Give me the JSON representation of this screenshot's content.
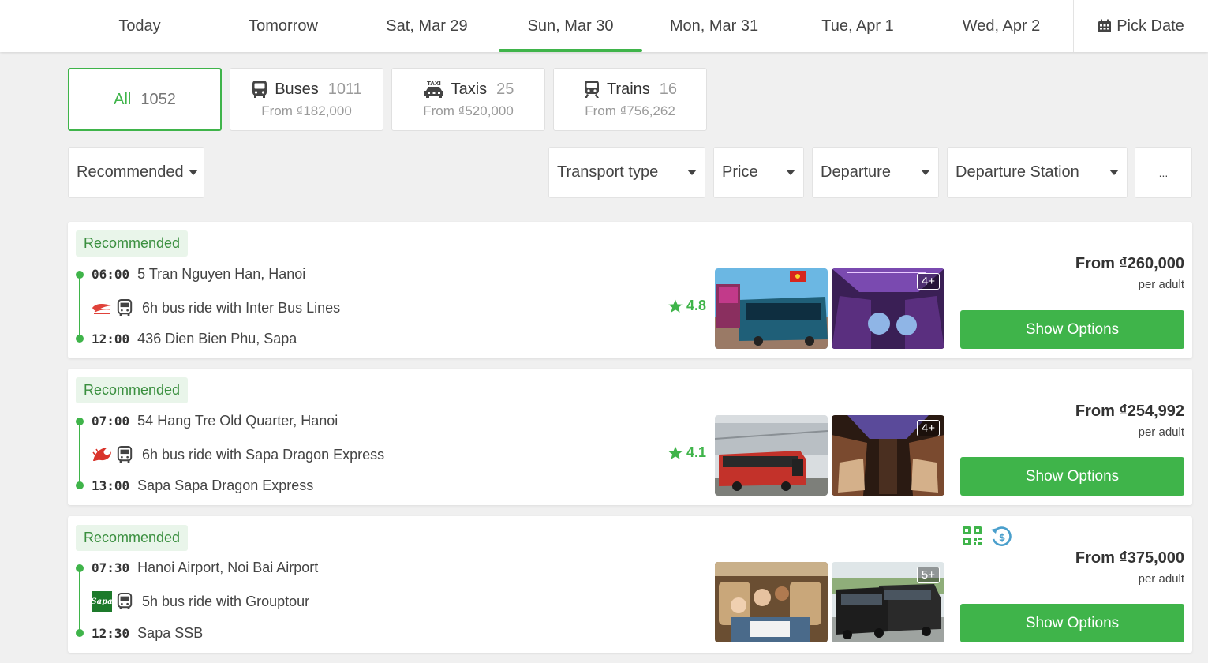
{
  "dates": [
    "Today",
    "Tomorrow",
    "Sat, Mar 29",
    "Sun, Mar 30",
    "Mon, Mar 31",
    "Tue, Apr 1",
    "Wed, Apr 2"
  ],
  "active_date_index": 3,
  "pick_date": {
    "label": "Pick Date",
    "icon": "calendar-icon"
  },
  "categories": [
    {
      "label": "All",
      "count": "1052",
      "from": "",
      "icon": ""
    },
    {
      "label": "Buses",
      "count": "1011",
      "from": "From ₫182,000",
      "icon": "bus-icon"
    },
    {
      "label": "Taxis",
      "count": "25",
      "from": "From ₫520,000",
      "icon": "taxi-icon"
    },
    {
      "label": "Trains",
      "count": "16",
      "from": "From ₫756,262",
      "icon": "train-icon"
    }
  ],
  "filters": {
    "sort": "Recommended",
    "transport_type": "Transport type",
    "price": "Price",
    "departure": "Departure",
    "departure_station": "Departure Station",
    "more": "..."
  },
  "colors": {
    "accent": "#3fb44a",
    "badge_bg": "#e9f5ea",
    "badge_text": "#3a8f3f"
  },
  "results": [
    {
      "badge": "Recommended",
      "dep_time": "06:00",
      "dep_place": "5 Tran Nguyen Han, Hanoi",
      "ride": "6h bus ride with Inter Bus Lines",
      "arr_time": "12:00",
      "arr_place": "436 Dien Bien Phu, Sapa",
      "rating": "4.8",
      "more_photos": "4+",
      "price": "From ₫260,000",
      "price_unit": "per adult",
      "button": "Show Options"
    },
    {
      "badge": "Recommended",
      "dep_time": "07:00",
      "dep_place": "54 Hang Tre Old Quarter, Hanoi",
      "ride": "6h bus ride with Sapa Dragon Express",
      "arr_time": "13:00",
      "arr_place": "Sapa Sapa Dragon Express",
      "rating": "4.1",
      "more_photos": "4+",
      "price": "From ₫254,992",
      "price_unit": "per adult",
      "button": "Show Options"
    },
    {
      "badge": "Recommended",
      "dep_time": "07:30",
      "dep_place": "Hanoi Airport, Noi Bai Airport",
      "ride": "5h bus ride with Grouptour",
      "arr_time": "12:30",
      "arr_place": "Sapa SSB",
      "logo_text": "Sapa",
      "more_photos": "5+",
      "price": "From ₫375,000",
      "price_unit": "per adult",
      "button": "Show Options"
    }
  ]
}
